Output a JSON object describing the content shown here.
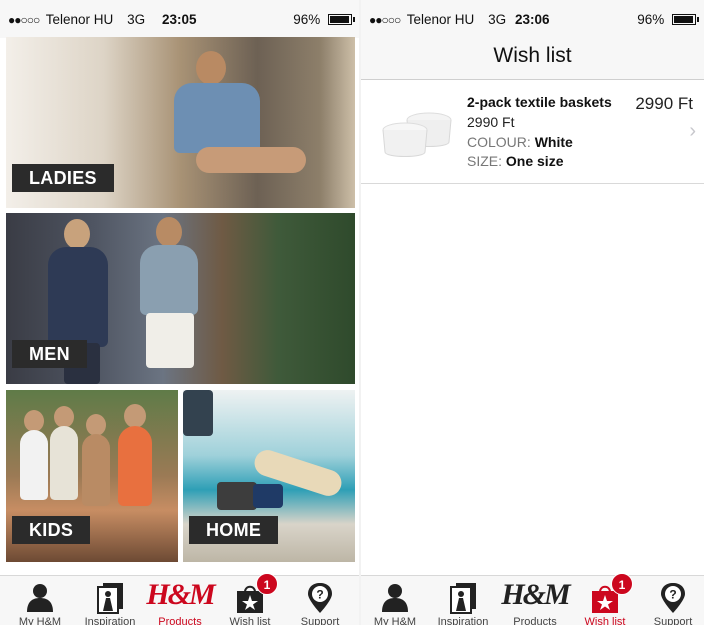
{
  "left_screen": {
    "status_bar": {
      "signal": "●●○○○",
      "carrier": "Telenor HU",
      "network": "3G",
      "time": "23:05",
      "battery": "96%",
      "battery_level": 0.96
    },
    "categories": [
      {
        "label": "LADIES"
      },
      {
        "label": "MEN"
      },
      {
        "label": "KIDS"
      },
      {
        "label": "HOME"
      }
    ],
    "tab_bar": {
      "tabs": [
        {
          "label": "My H&M",
          "icon": "person-icon"
        },
        {
          "label": "Inspiration",
          "icon": "inspiration-icon"
        },
        {
          "label": "Products",
          "icon": "hm-logo"
        },
        {
          "label": "Wish list",
          "icon": "shopping-bag-star-icon",
          "badge": "1"
        },
        {
          "label": "Support",
          "icon": "location-question-icon"
        }
      ],
      "active": "Products"
    }
  },
  "right_screen": {
    "status_bar": {
      "signal": "●●○○○",
      "carrier": "Telenor HU",
      "network": "3G",
      "time": "23:06",
      "battery": "96%",
      "battery_level": 0.96
    },
    "nav_title": "Wish list",
    "items": [
      {
        "name": "2-pack textile baskets",
        "price": "2990 Ft",
        "colour_label": "COLOUR:",
        "colour_value": "White",
        "size_label": "SIZE:",
        "size_value": "One size",
        "total": "2990 Ft"
      }
    ],
    "tab_bar": {
      "tabs": [
        {
          "label": "My H&M",
          "icon": "person-icon"
        },
        {
          "label": "Inspiration",
          "icon": "inspiration-icon"
        },
        {
          "label": "Products",
          "icon": "hm-logo"
        },
        {
          "label": "Wish list",
          "icon": "shopping-bag-star-icon",
          "badge": "1"
        },
        {
          "label": "Support",
          "icon": "location-question-icon"
        }
      ],
      "active": "Wish list"
    }
  },
  "logo_text": "H&M",
  "colors": {
    "accent": "#cc071e",
    "label_bg": "#2b2b2b",
    "bar_bg": "#f7f7f7"
  }
}
